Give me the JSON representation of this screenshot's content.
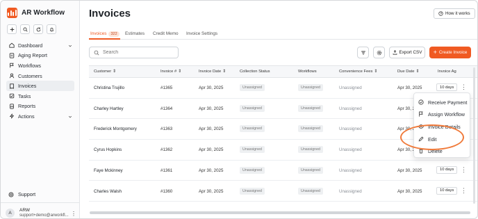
{
  "sidebar": {
    "brand": "AR Workflow",
    "items": [
      {
        "label": "Dashboard",
        "icon": "dashboard-icon",
        "expandable": true
      },
      {
        "label": "Aging Report",
        "icon": "aging-report-icon"
      },
      {
        "label": "Workflows",
        "icon": "workflows-icon"
      },
      {
        "label": "Customers",
        "icon": "customers-icon"
      },
      {
        "label": "Invoices",
        "icon": "invoices-icon",
        "active": true
      },
      {
        "label": "Tasks",
        "icon": "tasks-icon"
      },
      {
        "label": "Reports",
        "icon": "reports-icon"
      },
      {
        "label": "Actions",
        "icon": "actions-icon",
        "expandable": true
      }
    ],
    "support": "Support",
    "user": {
      "initial": "A",
      "name": "ARW",
      "email": "support+demo@arworkfl..."
    }
  },
  "page": {
    "title": "Invoices",
    "how_it_works": "How it works"
  },
  "tabs": [
    {
      "label": "Invoices",
      "count": "322",
      "active": true
    },
    {
      "label": "Estimates"
    },
    {
      "label": "Credit Memo"
    },
    {
      "label": "Invoice Settings"
    }
  ],
  "toolbar": {
    "search_placeholder": "Search",
    "export_label": "Export CSV",
    "create_label": "Create Invoice"
  },
  "table": {
    "columns": [
      "Customer",
      "Invoice #",
      "Invoice Date",
      "Collection Status",
      "Workflows",
      "Convenience Fees",
      "Due Date",
      "Invoice Ag"
    ],
    "rows": [
      {
        "customer": "Christina Trujillo",
        "invoice": "#1365",
        "date": "Apr 30, 2025",
        "status": "Unassigned",
        "workflow": "Unassigned",
        "fees": "Unassigned",
        "due": "Apr 30, 2025",
        "age": "10 days"
      },
      {
        "customer": "Charley Hartley",
        "invoice": "#1364",
        "date": "Apr 30, 2025",
        "status": "Unassigned",
        "workflow": "Unassigned",
        "fees": "Unassigned",
        "due": "Apr 30, 2025",
        "age": ""
      },
      {
        "customer": "Frederick Montgomery",
        "invoice": "#1363",
        "date": "Apr 30, 2025",
        "status": "Unassigned",
        "workflow": "Unassigned",
        "fees": "Unassigned",
        "due": "Apr 30, 2025",
        "age": ""
      },
      {
        "customer": "Cyrus Hopkins",
        "invoice": "#1362",
        "date": "Apr 30, 2025",
        "status": "Unassigned",
        "workflow": "Unassigned",
        "fees": "Unassigned",
        "due": "Apr 30, 2025",
        "age": ""
      },
      {
        "customer": "Faye Mckinney",
        "invoice": "#1361",
        "date": "Apr 30, 2025",
        "status": "Unassigned",
        "workflow": "Unassigned",
        "fees": "Unassigned",
        "due": "Apr 30, 2025",
        "age": "10 days"
      },
      {
        "customer": "Charles Walsh",
        "invoice": "#1360",
        "date": "Apr 30, 2025",
        "status": "Unassigned",
        "workflow": "Unassigned",
        "fees": "Unassigned",
        "due": "Apr 30, 2025",
        "age": "10 days"
      }
    ]
  },
  "context_menu": {
    "items": [
      {
        "label": "Receive Payment",
        "icon": "check-circle-icon"
      },
      {
        "label": "Assign Workflow",
        "icon": "flag-icon"
      },
      {
        "label": "Invoice Details",
        "icon": "eye-icon"
      },
      {
        "label": "Edit",
        "icon": "pencil-icon"
      },
      {
        "label": "Delete",
        "icon": "trash-icon"
      }
    ]
  },
  "colors": {
    "accent": "#f05a22",
    "callout": "#f07a3a"
  }
}
